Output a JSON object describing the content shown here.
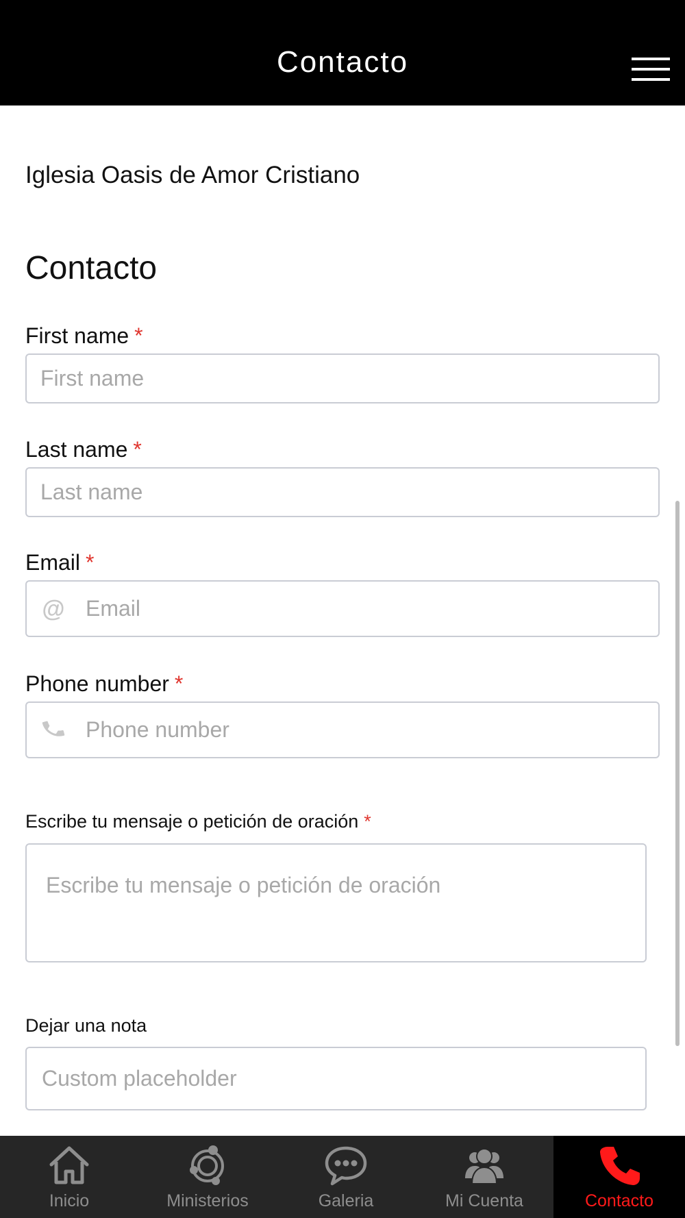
{
  "header": {
    "title": "Contacto"
  },
  "org_name": "Iglesia Oasis de Amor Cristiano",
  "section_title": "Contacto",
  "form": {
    "required_mark": "*",
    "first_name": {
      "label": "First name",
      "placeholder": "First name",
      "value": ""
    },
    "last_name": {
      "label": "Last name",
      "placeholder": "Last name",
      "value": ""
    },
    "email": {
      "label": "Email",
      "placeholder": "Email",
      "value": "",
      "icon": "at-icon"
    },
    "phone": {
      "label": "Phone number",
      "placeholder": "Phone number",
      "value": "",
      "icon": "phone-icon"
    },
    "message": {
      "label": "Escribe tu mensaje o petición de oración",
      "placeholder": "Escribe tu mensaje o petición de oración",
      "value": ""
    },
    "note": {
      "label": "Dejar una nota",
      "placeholder": "Custom placeholder",
      "value": ""
    }
  },
  "bottom_nav": {
    "items": [
      {
        "label": "Inicio",
        "icon": "home-icon",
        "active": false
      },
      {
        "label": "Ministerios",
        "icon": "orbit-icon",
        "active": false
      },
      {
        "label": "Galeria",
        "icon": "chat-bubble-icon",
        "active": false
      },
      {
        "label": "Mi Cuenta",
        "icon": "users-icon",
        "active": false
      },
      {
        "label": "Contacto",
        "icon": "phone-icon",
        "active": true
      }
    ]
  },
  "colors": {
    "header_bg": "#000000",
    "nav_bg": "#262626",
    "active_nav_bg": "#000000",
    "accent_red": "#ff1a1a",
    "required_red": "#e0362f",
    "nav_inactive": "#8e8e8e"
  }
}
